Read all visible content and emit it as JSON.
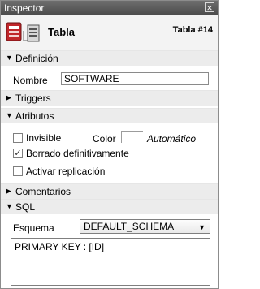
{
  "window": {
    "title": "Inspector",
    "close_glyph": "✕"
  },
  "header": {
    "name": "Tabla",
    "number": "Tabla #14",
    "icons": [
      "table-icon",
      "inspector-doc-icon"
    ]
  },
  "sections": {
    "definicion": "Definición",
    "triggers": "Triggers",
    "atributos": "Atributos",
    "comentarios": "Comentarios",
    "sql": "SQL"
  },
  "definicion": {
    "nombre_label": "Nombre",
    "nombre_value": "SOFTWARE"
  },
  "atributos": {
    "invisible_label": "Invisible",
    "invisible_checked": false,
    "color_label": "Color",
    "color_value": "Automático",
    "borrado_label": "Borrado definitivamente",
    "borrado_checked": true,
    "replicacion_label": "Activar replicación",
    "replicacion_checked": false
  },
  "sql": {
    "esquema_label": "Esquema",
    "esquema_value": "DEFAULT_SCHEMA",
    "code": "PRIMARY KEY : [ID]"
  },
  "glyphs": {
    "expanded": "▼",
    "collapsed": "▶",
    "check": "✓"
  }
}
